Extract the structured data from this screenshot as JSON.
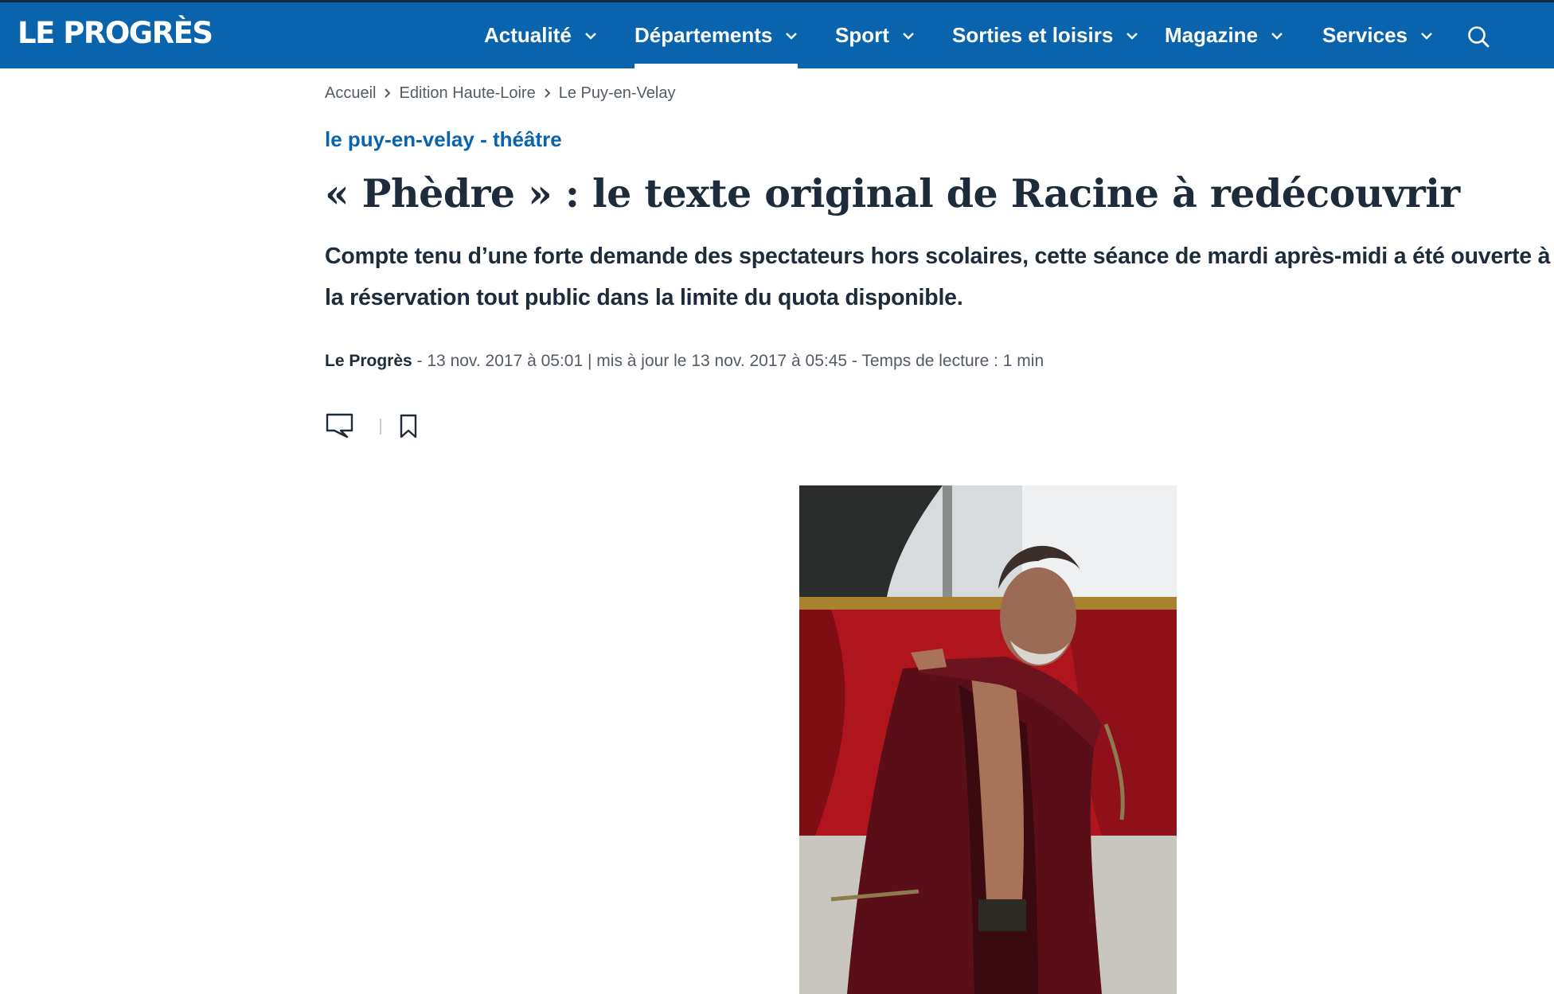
{
  "header": {
    "logo_text": "LE PROGRÈS",
    "brand_color": "#0a64ad",
    "nav": [
      {
        "label": "Actualité",
        "active": false
      },
      {
        "label": "Départements",
        "active": true
      },
      {
        "label": "Sport",
        "active": false
      },
      {
        "label": "Sorties et loisirs",
        "active": false
      },
      {
        "label": "Magazine",
        "active": false
      },
      {
        "label": "Services",
        "active": false
      }
    ],
    "search_icon": "search-icon"
  },
  "breadcrumb": [
    "Accueil",
    "Edition Haute-Loire",
    "Le Puy-en-Velay"
  ],
  "article": {
    "kicker": "le puy-en-velay - théâtre",
    "title": "« Phèdre » : le texte original de Racine à redécouvrir",
    "lede": "Compte tenu d’une forte demande des spectateurs hors scolaires, cette séance de mardi après-midi a été ouverte à la réservation tout public dans la limite du quota disponible.",
    "meta": {
      "source": "Le Progrès",
      "rest": " - 13 nov. 2017 à 05:01 | mis à jour le 13 nov. 2017 à 05:45 - Temps de lecture : 1 min"
    },
    "actions": {
      "comment_icon": "comment-icon",
      "bookmark_icon": "bookmark-icon"
    },
    "image": {
      "subject": "actor-in-red-robe-photo"
    }
  }
}
